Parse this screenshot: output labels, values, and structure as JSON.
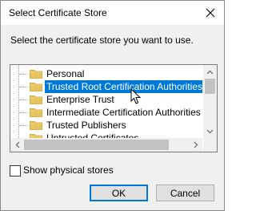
{
  "dialog": {
    "title": "Select Certificate Store",
    "instruction": "Select the certificate store you want to use.",
    "close_icon": "close-icon"
  },
  "tree": {
    "items": [
      {
        "label": "Personal",
        "selected": false
      },
      {
        "label": "Trusted Root Certification Authorities",
        "selected": true
      },
      {
        "label": "Enterprise Trust",
        "selected": false
      },
      {
        "label": "Intermediate Certification Authorities",
        "selected": false
      },
      {
        "label": "Trusted Publishers",
        "selected": false
      },
      {
        "label": "Untrusted Certificates",
        "selected": false
      }
    ]
  },
  "options": {
    "show_physical_label": "Show physical stores",
    "show_physical_checked": false
  },
  "buttons": {
    "ok_label": "OK",
    "cancel_label": "Cancel"
  },
  "colors": {
    "selection": "#0078d7",
    "folder": "#e8c460"
  }
}
